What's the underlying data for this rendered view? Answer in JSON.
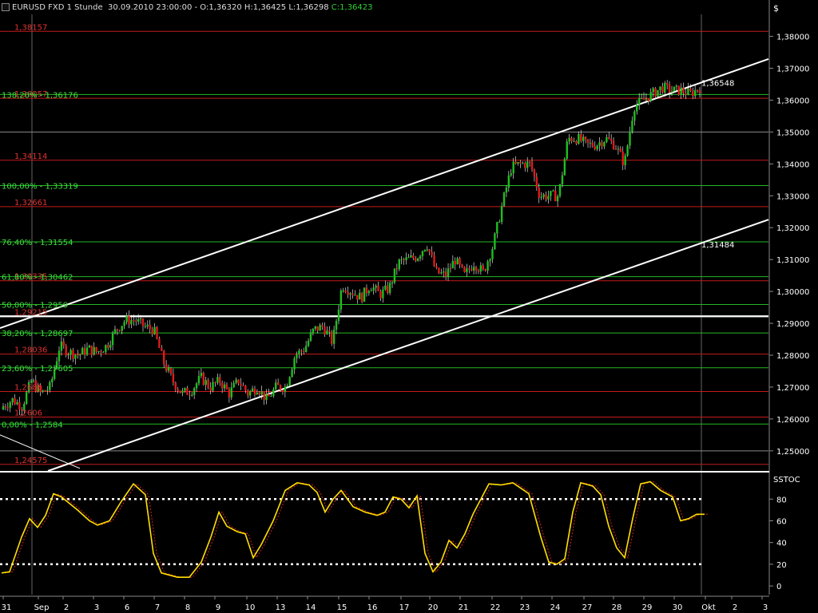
{
  "header": {
    "symbol": "EURUSD FXD 1 Stunde",
    "datetime": "30.09.2010 23:00:00",
    "ohlc": "O:1,36320 H:1,36425 L:1,36298",
    "close": "C:1,36423"
  },
  "colors": {
    "background": "#000000",
    "up_candle": "#1fbf1f",
    "down_candle": "#e01a1a",
    "fib_line": "#23b823",
    "sr_line": "#c41a1a",
    "channel": "#ffffff",
    "stoch_k": "#ffe000",
    "stoch_d": "#d62020"
  },
  "chart_data": [
    {
      "type": "candlestick",
      "currency_label": "$",
      "ylim": [
        1.2437,
        1.3869
      ],
      "y_ticks": [
        "1,38000",
        "1,37000",
        "1,36000",
        "1,35000",
        "1,34000",
        "1,33000",
        "1,32000",
        "1,31000",
        "1,30000",
        "1,29000",
        "1,28000",
        "1,27000",
        "1,26000",
        "1,25000"
      ],
      "x_ticks": [
        "31",
        "Sep",
        "2",
        "3",
        "6",
        "7",
        "8",
        "9",
        "10",
        "13",
        "14",
        "15",
        "16",
        "17",
        "20",
        "21",
        "22",
        "23",
        "24",
        "27",
        "28",
        "29",
        "30",
        "Okt",
        "2",
        "3"
      ],
      "fib_levels": [
        {
          "label": "138,20% - 1,36176",
          "value": 1.36176
        },
        {
          "label": "100,00% - 1,33319",
          "value": 1.33319
        },
        {
          "label": "76,40% - 1,31554",
          "value": 1.31554
        },
        {
          "label": "61,80% - 1,30462",
          "value": 1.30462
        },
        {
          "label": "50,00% - 1,2959",
          "value": 1.2959
        },
        {
          "label": "38,20% - 1,28697",
          "value": 1.28697
        },
        {
          "label": "23,60% - 1,27605",
          "value": 1.27605
        },
        {
          "label": "0,00% - 1,2584",
          "value": 1.2584
        }
      ],
      "sr_levels": [
        {
          "label": "1,38157",
          "value": 1.38157
        },
        {
          "label": "1,36057",
          "value": 1.36057
        },
        {
          "label": "1,34114",
          "value": 1.34114
        },
        {
          "label": "1,32661",
          "value": 1.32661
        },
        {
          "label": "1,30335",
          "value": 1.30335
        },
        {
          "label": "1,29215",
          "value": 1.29215
        },
        {
          "label": "1,28036",
          "value": 1.28036
        },
        {
          "label": "1,2686",
          "value": 1.2686
        },
        {
          "label": "1,2606",
          "value": 1.2606
        },
        {
          "label": "1,24575",
          "value": 1.24575
        }
      ],
      "gray_levels": [
        1.35,
        1.292,
        1.25
      ],
      "price_labels": [
        "1,36548",
        "1,31484"
      ],
      "price_label_values": [
        1.36548,
        1.31484
      ],
      "channel_upper": [
        1.2885,
        1.3729
      ],
      "channel_lower": [
        1.2437,
        1.3225
      ],
      "path": [
        1.264,
        1.266,
        1.264,
        1.272,
        1.268,
        1.27,
        1.283,
        1.281,
        1.28,
        1.282,
        1.281,
        1.283,
        1.288,
        1.291,
        1.291,
        1.289,
        1.288,
        1.278,
        1.272,
        1.268,
        1.269,
        1.273,
        1.27,
        1.272,
        1.268,
        1.272,
        1.268,
        1.27,
        1.266,
        1.27,
        1.27,
        1.28,
        1.282,
        1.288,
        1.289,
        1.284,
        1.302,
        1.3,
        1.298,
        1.302,
        1.299,
        1.301,
        1.309,
        1.31,
        1.311,
        1.315,
        1.306,
        1.305,
        1.31,
        1.305,
        1.309,
        1.306,
        1.314,
        1.327,
        1.339,
        1.34,
        1.34,
        1.33,
        1.33,
        1.33,
        1.348,
        1.348,
        1.346,
        1.346,
        1.348,
        1.346,
        1.34,
        1.358,
        1.36,
        1.362,
        1.364,
        1.363,
        1.363,
        1.362,
        1.364
      ]
    },
    {
      "type": "line",
      "title": "SSTOC",
      "ylim": [
        -8,
        103
      ],
      "y_ticks": [
        0,
        20,
        40,
        60,
        80
      ],
      "levels": [
        20,
        80
      ],
      "k_points": [
        [
          0,
          12
        ],
        [
          10,
          13
        ],
        [
          25,
          45
        ],
        [
          35,
          62
        ],
        [
          45,
          54
        ],
        [
          55,
          65
        ],
        [
          65,
          85
        ],
        [
          75,
          82
        ],
        [
          95,
          70
        ],
        [
          110,
          60
        ],
        [
          120,
          56
        ],
        [
          135,
          60
        ],
        [
          150,
          78
        ],
        [
          165,
          94
        ],
        [
          180,
          84
        ],
        [
          190,
          30
        ],
        [
          200,
          12
        ],
        [
          220,
          8
        ],
        [
          235,
          8
        ],
        [
          250,
          22
        ],
        [
          262,
          45
        ],
        [
          272,
          68
        ],
        [
          282,
          55
        ],
        [
          295,
          50
        ],
        [
          305,
          48
        ],
        [
          315,
          26
        ],
        [
          325,
          38
        ],
        [
          340,
          60
        ],
        [
          355,
          88
        ],
        [
          370,
          95
        ],
        [
          385,
          93
        ],
        [
          395,
          86
        ],
        [
          405,
          68
        ],
        [
          415,
          80
        ],
        [
          425,
          88
        ],
        [
          440,
          73
        ],
        [
          455,
          68
        ],
        [
          470,
          65
        ],
        [
          480,
          68
        ],
        [
          490,
          82
        ],
        [
          500,
          80
        ],
        [
          510,
          72
        ],
        [
          520,
          83
        ],
        [
          530,
          30
        ],
        [
          540,
          13
        ],
        [
          550,
          22
        ],
        [
          560,
          42
        ],
        [
          570,
          35
        ],
        [
          580,
          48
        ],
        [
          590,
          66
        ],
        [
          600,
          80
        ],
        [
          610,
          94
        ],
        [
          625,
          93
        ],
        [
          640,
          95
        ],
        [
          650,
          90
        ],
        [
          660,
          85
        ],
        [
          675,
          45
        ],
        [
          685,
          22
        ],
        [
          695,
          20
        ],
        [
          705,
          25
        ],
        [
          715,
          68
        ],
        [
          725,
          95
        ],
        [
          740,
          92
        ],
        [
          750,
          84
        ],
        [
          760,
          55
        ],
        [
          770,
          35
        ],
        [
          780,
          26
        ],
        [
          790,
          62
        ],
        [
          800,
          94
        ],
        [
          812,
          96
        ],
        [
          825,
          88
        ],
        [
          840,
          82
        ],
        [
          850,
          60
        ],
        [
          860,
          62
        ],
        [
          870,
          66
        ],
        [
          880,
          66
        ]
      ]
    }
  ]
}
